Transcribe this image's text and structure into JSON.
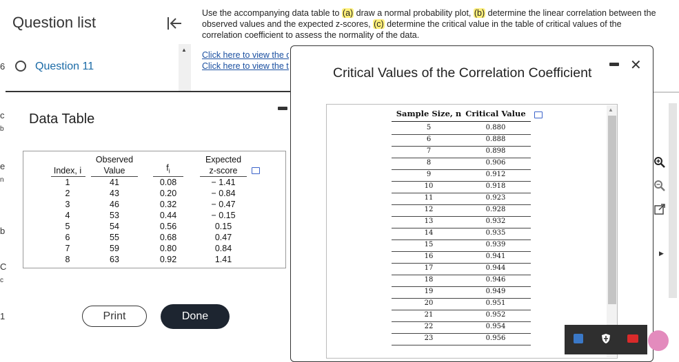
{
  "question_list": {
    "title": "Question list",
    "question_label": "Question 11"
  },
  "instructions": {
    "segments": [
      {
        "text": "Use the accompanying data table to ",
        "highlight": false
      },
      {
        "text": "(a)",
        "highlight": true
      },
      {
        "text": " draw a normal probability plot, ",
        "highlight": false
      },
      {
        "text": "(b)",
        "highlight": true
      },
      {
        "text": " determine the linear correlation between the observed values and the expected z-scores, ",
        "highlight": false
      },
      {
        "text": "(c)",
        "highlight": true
      },
      {
        "text": " determine the critical value in the table of critical values of the correlation coefficient to assess the normality of the data.",
        "highlight": false
      }
    ],
    "links": [
      "Click here to view the data table.",
      "Click here to view the table of critical values."
    ]
  },
  "data_table": {
    "title": "Data Table",
    "headers": {
      "index": "Index, i",
      "observed_line1": "Observed",
      "observed_line2": "Value",
      "f": "f",
      "f_sub": "i",
      "expected_line1": "Expected",
      "expected_line2": "z-score"
    },
    "rows": [
      {
        "i": "1",
        "value": "41",
        "f": "0.08",
        "z": "− 1.41"
      },
      {
        "i": "2",
        "value": "43",
        "f": "0.20",
        "z": "− 0.84"
      },
      {
        "i": "3",
        "value": "46",
        "f": "0.32",
        "z": "− 0.47"
      },
      {
        "i": "4",
        "value": "53",
        "f": "0.44",
        "z": "− 0.15"
      },
      {
        "i": "5",
        "value": "54",
        "f": "0.56",
        "z": "0.15"
      },
      {
        "i": "6",
        "value": "55",
        "f": "0.68",
        "z": "0.47"
      },
      {
        "i": "7",
        "value": "59",
        "f": "0.80",
        "z": "0.84"
      },
      {
        "i": "8",
        "value": "63",
        "f": "0.92",
        "z": "1.41"
      }
    ],
    "print_label": "Print",
    "done_label": "Done"
  },
  "critical_values": {
    "title": "Critical Values of the Correlation Coefficient",
    "header_n": "Sample Size, n",
    "header_value": "Critical Value",
    "close_glyph": "✕",
    "rows": [
      {
        "n": "5",
        "v": "0.880"
      },
      {
        "n": "6",
        "v": "0.888"
      },
      {
        "n": "7",
        "v": "0.898"
      },
      {
        "n": "8",
        "v": "0.906"
      },
      {
        "n": "9",
        "v": "0.912"
      },
      {
        "n": "10",
        "v": "0.918"
      },
      {
        "n": "11",
        "v": "0.923"
      },
      {
        "n": "12",
        "v": "0.928"
      },
      {
        "n": "13",
        "v": "0.932"
      },
      {
        "n": "14",
        "v": "0.935"
      },
      {
        "n": "15",
        "v": "0.939"
      },
      {
        "n": "16",
        "v": "0.941"
      },
      {
        "n": "17",
        "v": "0.944"
      },
      {
        "n": "18",
        "v": "0.946"
      },
      {
        "n": "19",
        "v": "0.949"
      },
      {
        "n": "20",
        "v": "0.951"
      },
      {
        "n": "21",
        "v": "0.952"
      },
      {
        "n": "22",
        "v": "0.954"
      },
      {
        "n": "23",
        "v": "0.956"
      }
    ]
  },
  "left_edge_fragments": [
    "6",
    "c",
    "b",
    "e",
    "n",
    "b",
    "C",
    "c",
    "1"
  ],
  "icons": {
    "collapse": "collapse-left-icon",
    "zoom_in": "zoom-in-icon",
    "zoom_out": "zoom-out-icon",
    "expand": "popout-icon",
    "copy": "copy-icon"
  },
  "colors": {
    "link": "#1a4fa0",
    "question_label": "#1a6aa6",
    "highlight": "#fff07a",
    "done_button": "#1d2530",
    "copy_icon": "#3a62c9"
  }
}
